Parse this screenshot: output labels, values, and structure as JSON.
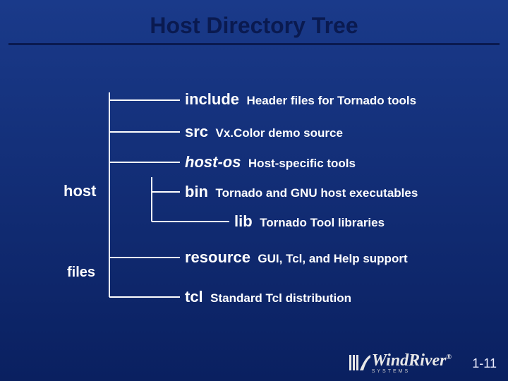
{
  "title": "Host Directory Tree",
  "page_number": "1-11",
  "logo": {
    "text": "WindRiver",
    "subtext": "SYSTEMS",
    "reg": "®"
  },
  "tree": {
    "host": {
      "label": "host",
      "children": {
        "include": {
          "name": "include",
          "desc": "Header files for Tornado tools"
        },
        "src": {
          "name": "src",
          "desc": "Vx.Color demo source"
        },
        "hostos": {
          "name": "host-os",
          "desc": "Host-specific tools",
          "children": {
            "bin": {
              "name": "bin",
              "desc": "Tornado and GNU host executables"
            },
            "lib": {
              "name": "lib",
              "desc": "Tornado Tool libraries"
            }
          }
        },
        "resource": {
          "name": "resource",
          "desc": "GUI, Tcl, and Help support"
        },
        "tcl": {
          "name": "tcl",
          "desc": "Standard Tcl distribution"
        }
      }
    },
    "files": {
      "label": "files"
    }
  }
}
